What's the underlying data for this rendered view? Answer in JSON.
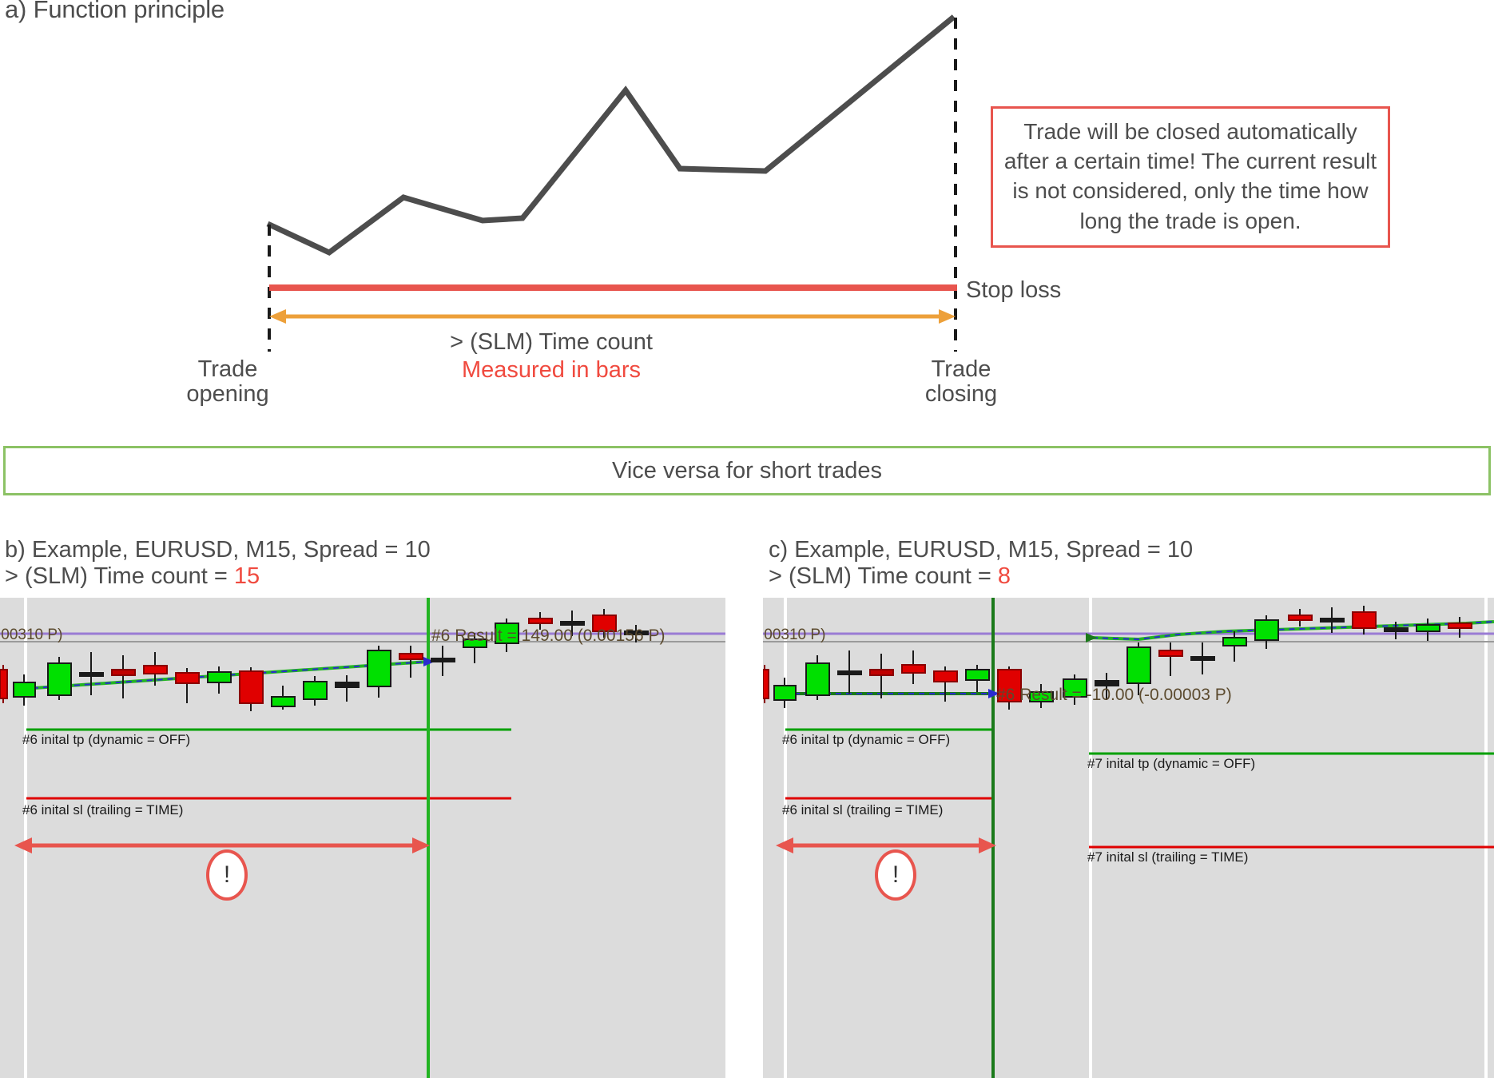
{
  "section_a": {
    "title": "a) Function principle",
    "callout": "Trade will be closed automatically after a certain time! The current result is not considered, only the time how long the trade is open.",
    "stop_loss_label": "Stop loss",
    "time_count_label": "> (SLM) Time count",
    "measured_label": "Measured in bars",
    "trade_opening_label": "Trade\nopening",
    "trade_closing_label": "Trade\nclosing",
    "colors": {
      "price_line": "#4d4d4d",
      "stop_loss": "#e8554e",
      "time_arrow": "#eda03a",
      "callout_border": "#e8554e",
      "accent_red": "#f04a3f"
    }
  },
  "vice_versa": {
    "text": "Vice versa for short trades",
    "border_color": "#8cc265"
  },
  "section_b": {
    "heading_line1": "b) Example, EURUSD, M15, Spread = 10",
    "heading_line2_prefix": "> (SLM) Time count = ",
    "heading_line2_value": "15",
    "chart": {
      "tp_label": "#6 inital tp (dynamic = OFF)",
      "sl_label": "#6 inital sl (trailing = TIME)",
      "price_label": ".00310 P)",
      "result_label": "#6 Result = 149.00 (0.00156 P)",
      "marker": "!"
    }
  },
  "section_c": {
    "heading_line1": "c) Example, EURUSD, M15, Spread = 10",
    "heading_line2_prefix": "> (SLM) Time count = ",
    "heading_line2_value": "8",
    "chart": {
      "tp_label": "#6 inital tp (dynamic = OFF)",
      "sl_label": "#6 inital sl (trailing = TIME)",
      "tp7_label": "#7 inital tp (dynamic = OFF)",
      "sl7_label": "#7 inital sl (trailing = TIME)",
      "price_label": ".00310 P)",
      "result_label": "#6 Result = -10.00 (-0.00003 P)",
      "marker": "!"
    }
  },
  "chart_data": {
    "type": "line",
    "title": "a) Function principle",
    "xlabel": "",
    "ylabel": "",
    "grid": false,
    "legend": "none",
    "annotations": [
      "Stop loss",
      "> (SLM) Time count",
      "Measured in bars",
      "Trade opening",
      "Trade closing",
      "Trade will be closed automatically after a certain time! The current result is not considered, only the time how long the trade is open."
    ],
    "series": [
      {
        "name": "price",
        "points": [
          [
            335,
            280
          ],
          [
            412,
            316
          ],
          [
            505,
            247
          ],
          [
            604,
            276
          ],
          [
            654,
            273
          ],
          [
            783,
            113
          ],
          [
            851,
            211
          ],
          [
            958,
            214
          ],
          [
            1194,
            21
          ]
        ]
      },
      {
        "name": "stop loss",
        "points": [
          [
            335,
            357
          ],
          [
            1194,
            357
          ]
        ]
      }
    ],
    "candles_b": {
      "type": "candlestick",
      "note": "EURUSD M15, Spread = 10, SLM Time count = 15; 22 bars, close line at bar 15",
      "bars": [
        {
          "o": 155,
          "h": 140,
          "l": 175,
          "c": 172,
          "dir": "down"
        },
        {
          "o": 165,
          "h": 148,
          "l": 175,
          "c": 152,
          "dir": "up"
        },
        {
          "o": 148,
          "h": 122,
          "l": 160,
          "c": 122,
          "dir": "up"
        },
        {
          "o": 132,
          "h": 112,
          "l": 160,
          "c": 132,
          "dir": "doji"
        },
        {
          "o": 127,
          "h": 113,
          "l": 160,
          "c": 131,
          "dir": "down"
        },
        {
          "o": 118,
          "h": 105,
          "l": 140,
          "c": 124,
          "dir": "down"
        },
        {
          "o": 130,
          "h": 126,
          "l": 150,
          "c": 137,
          "dir": "down"
        },
        {
          "o": 136,
          "h": 126,
          "l": 145,
          "c": 130,
          "dir": "up"
        },
        {
          "o": 126,
          "h": 124,
          "l": 170,
          "c": 165,
          "dir": "down"
        },
        {
          "o": 160,
          "h": 152,
          "l": 172,
          "c": 158,
          "dir": "up"
        },
        {
          "o": 158,
          "h": 140,
          "l": 162,
          "c": 141,
          "dir": "up"
        },
        {
          "o": 143,
          "h": 132,
          "l": 150,
          "c": 136,
          "dir": "up"
        },
        {
          "o": 140,
          "h": 103,
          "l": 145,
          "c": 108,
          "dir": "up"
        },
        {
          "o": 105,
          "h": 97,
          "l": 115,
          "c": 102,
          "dir": "down"
        },
        {
          "o": 102,
          "h": 92,
          "l": 110,
          "c": 94,
          "dir": "doji"
        },
        {
          "o": 96,
          "h": 88,
          "l": 100,
          "c": 90,
          "dir": "up"
        },
        {
          "o": 88,
          "h": 72,
          "l": 93,
          "c": 74,
          "dir": "up"
        },
        {
          "o": 72,
          "h": 60,
          "l": 80,
          "c": 63,
          "dir": "up"
        },
        {
          "o": 58,
          "h": 52,
          "l": 62,
          "c": 58,
          "dir": "down"
        },
        {
          "o": 56,
          "h": 48,
          "l": 68,
          "c": 58,
          "dir": "doji"
        },
        {
          "o": 52,
          "h": 46,
          "l": 70,
          "c": 66,
          "dir": "down"
        },
        {
          "o": 62,
          "h": 58,
          "l": 66,
          "c": 62,
          "dir": "doji"
        }
      ]
    },
    "candles_c": {
      "type": "candlestick",
      "note": "EURUSD M15, Spread = 10, SLM Time count = 8; close line at bar 8, second trade #7 opens later",
      "bars": [
        {
          "dir": "down"
        },
        {
          "dir": "up"
        },
        {
          "dir": "up"
        },
        {
          "dir": "doji"
        },
        {
          "dir": "down"
        },
        {
          "dir": "down"
        },
        {
          "dir": "down"
        },
        {
          "dir": "up"
        },
        {
          "dir": "down"
        },
        {
          "dir": "up"
        },
        {
          "dir": "up"
        },
        {
          "dir": "up"
        },
        {
          "dir": "up"
        },
        {
          "dir": "down"
        },
        {
          "dir": "doji"
        },
        {
          "dir": "up"
        },
        {
          "dir": "up"
        },
        {
          "dir": "up"
        },
        {
          "dir": "down"
        },
        {
          "dir": "doji"
        },
        {
          "dir": "down"
        },
        {
          "dir": "doji"
        }
      ]
    }
  }
}
